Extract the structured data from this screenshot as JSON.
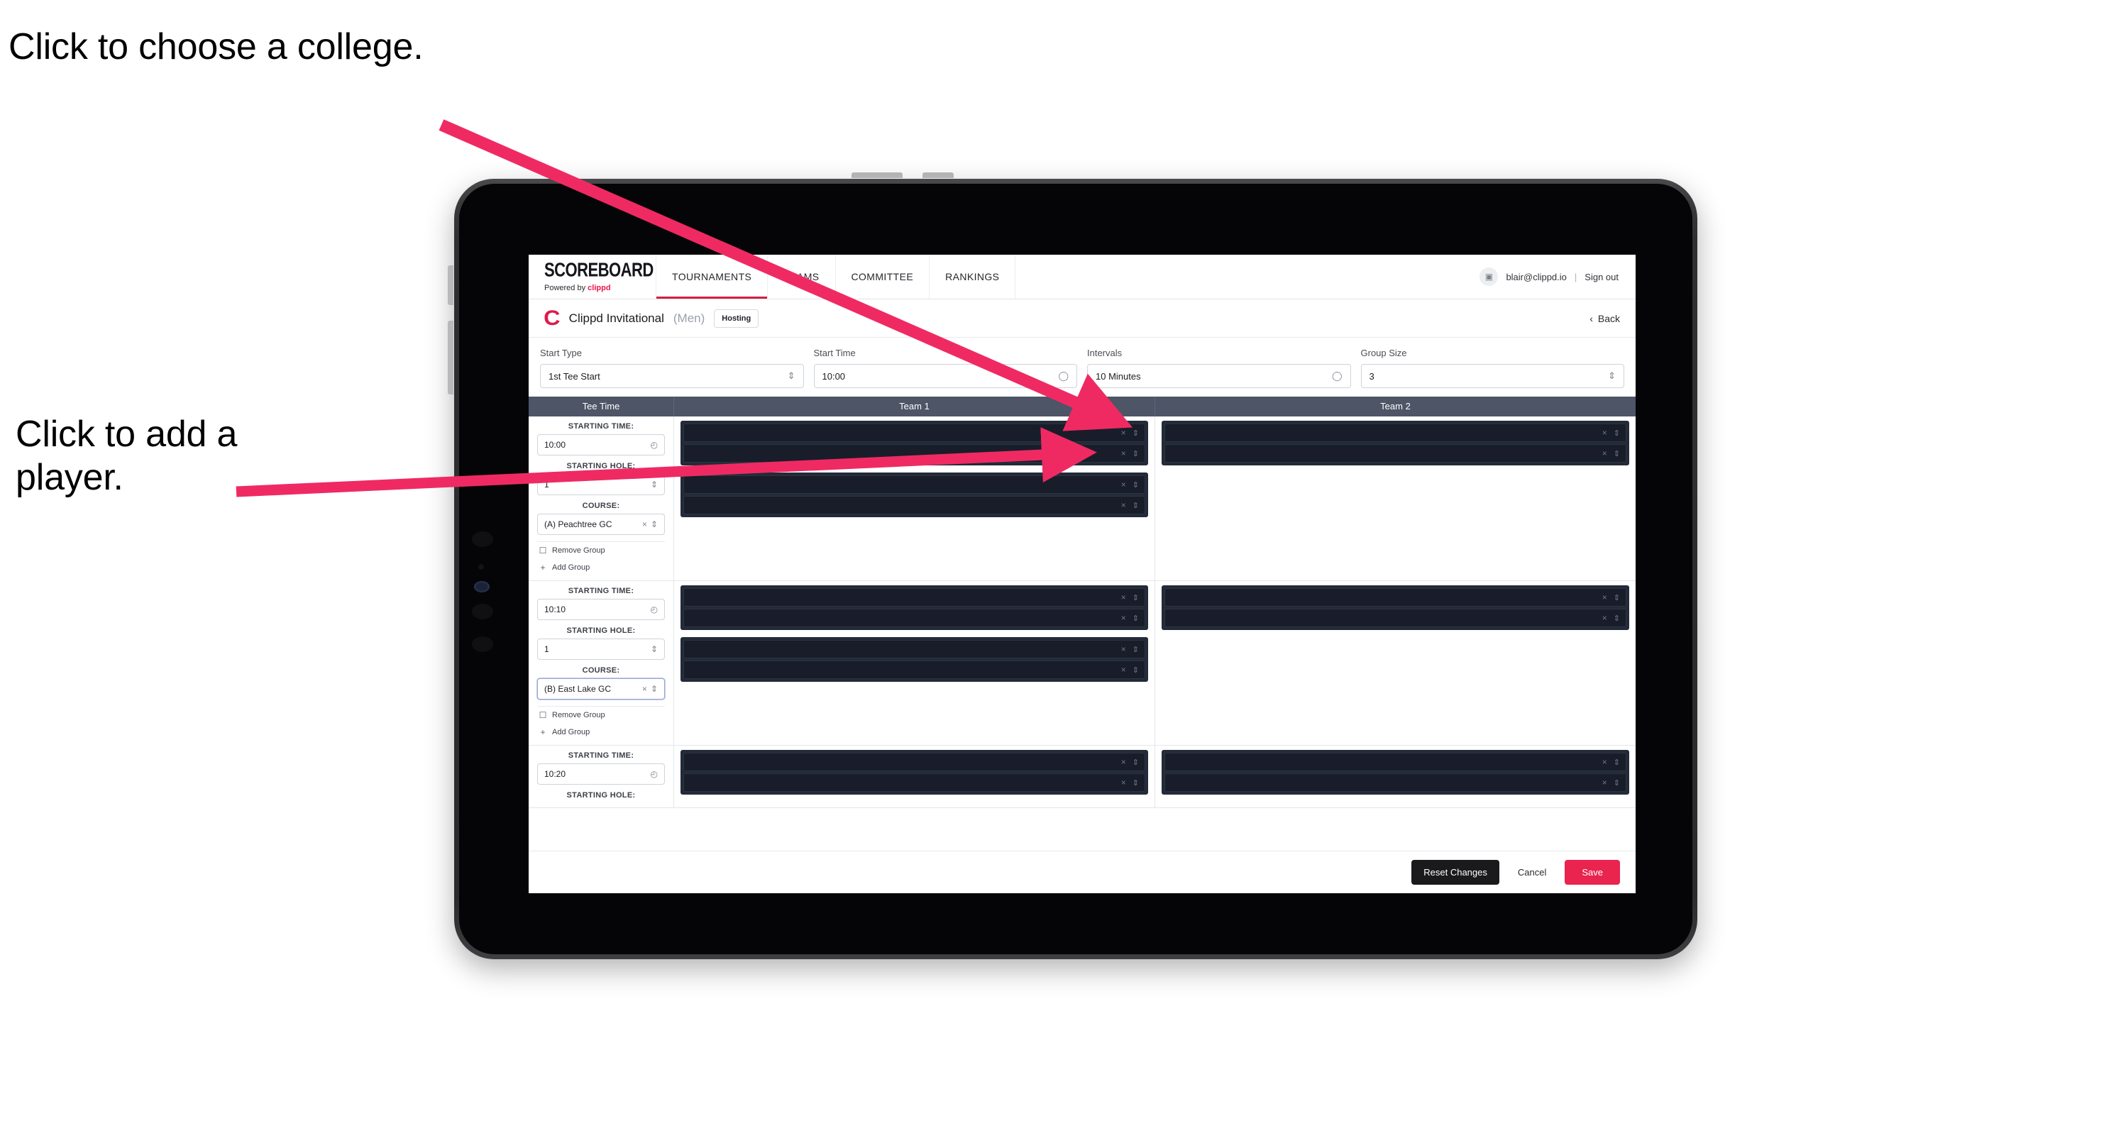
{
  "annotations": {
    "college": "Click to choose a college.",
    "player": "Click to add a player."
  },
  "colors": {
    "accent_pink": "#e8244f",
    "annotation_arrow": "#ef2a63",
    "nav_active_underline": "#d21f45",
    "table_header_bg": "#4d5567",
    "player_row_bg": "#181d29"
  },
  "topnav": {
    "brand_word": "SCOREBOARD",
    "brand_sub_prefix": "Powered by",
    "brand_sub_accent": "clippd",
    "tabs": [
      {
        "label": "TOURNAMENTS",
        "active": true
      },
      {
        "label": "TEAMS",
        "active": false
      },
      {
        "label": "COMMITTEE",
        "active": false
      },
      {
        "label": "RANKINGS",
        "active": false
      }
    ],
    "avatar_icon": "user-avatar-icon",
    "email": "blair@clippd.io",
    "separator": "|",
    "sign_out": "Sign out"
  },
  "tournament_bar": {
    "logo_letter": "C",
    "name": "Clippd Invitational",
    "gender": "(Men)",
    "badge": "Hosting",
    "back_chevron": "‹",
    "back_label": "Back"
  },
  "filters": [
    {
      "label": "Start Type",
      "value": "1st Tee Start",
      "icon": "stepper-icon"
    },
    {
      "label": "Start Time",
      "value": "10:00",
      "icon": "clock-icon"
    },
    {
      "label": "Intervals",
      "value": "10 Minutes",
      "icon": "clock-icon"
    },
    {
      "label": "Group Size",
      "value": "3",
      "icon": "stepper-icon"
    }
  ],
  "table": {
    "headers": [
      "Tee Time",
      "Team 1",
      "Team 2"
    ],
    "labels": {
      "starting_time": "STARTING TIME:",
      "starting_hole": "STARTING HOLE:",
      "course": "COURSE:",
      "remove_group": "Remove Group",
      "add_group": "Add Group"
    },
    "rows": [
      {
        "starting_time": "10:00",
        "starting_hole": "1",
        "course": "(A) Peachtree GC",
        "course_focused": false,
        "team1": [
          {
            "players": [
              "",
              ""
            ]
          },
          {
            "players": [
              "",
              ""
            ]
          }
        ],
        "team2": [
          {
            "players": [
              "",
              ""
            ]
          }
        ]
      },
      {
        "starting_time": "10:10",
        "starting_hole": "1",
        "course": "(B) East Lake GC",
        "course_focused": true,
        "team1": [
          {
            "players": [
              "",
              ""
            ]
          },
          {
            "players": [
              "",
              ""
            ]
          }
        ],
        "team2": [
          {
            "players": [
              "",
              ""
            ]
          }
        ]
      },
      {
        "starting_time": "10:20",
        "starting_hole": "",
        "course": "",
        "course_focused": false,
        "team1": [
          {
            "players": [
              "",
              ""
            ]
          }
        ],
        "team2": [
          {
            "players": [
              "",
              ""
            ]
          }
        ]
      }
    ],
    "row_icons": {
      "clock": "clock-icon",
      "stepper": "stepper-icon",
      "clear": "×",
      "remove": "trash-icon",
      "add": "+"
    }
  },
  "footer": {
    "reset": "Reset Changes",
    "cancel": "Cancel",
    "save": "Save"
  }
}
